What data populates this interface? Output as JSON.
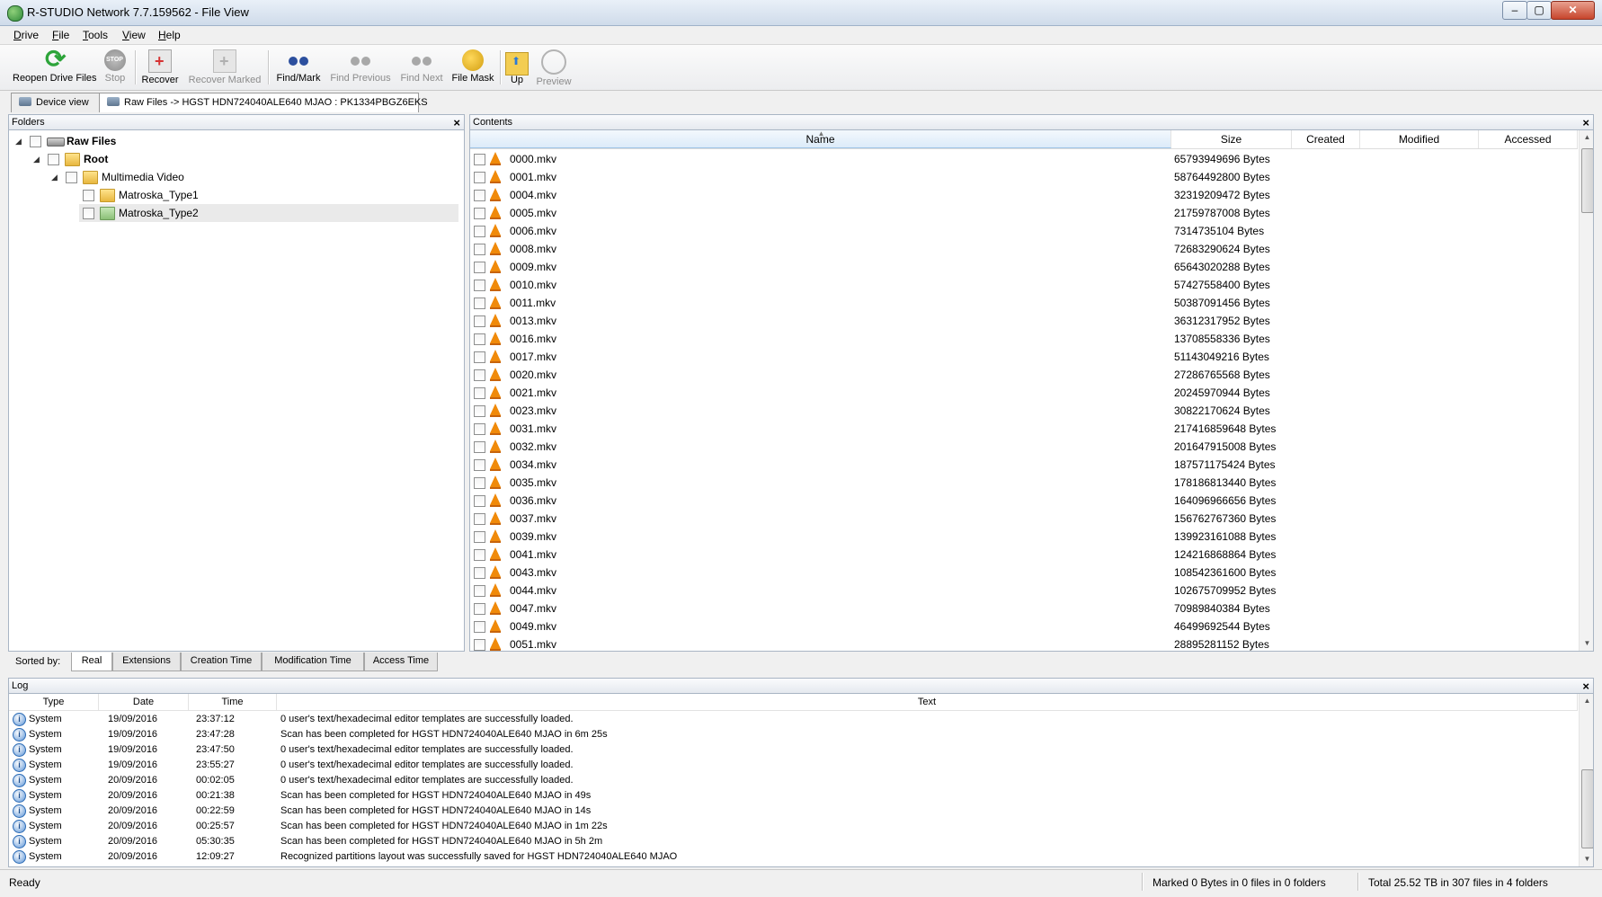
{
  "window": {
    "title": "R-STUDIO Network 7.7.159562 - File View",
    "min": "–",
    "max": "▢",
    "close": "✕"
  },
  "menu": [
    "Drive",
    "File",
    "Tools",
    "View",
    "Help"
  ],
  "toolbar": {
    "reopen": "Reopen Drive Files",
    "stop": "Stop",
    "recover": "Recover",
    "recover_marked": "Recover Marked",
    "find_mark": "Find/Mark",
    "find_previous": "Find Previous",
    "find_next": "Find Next",
    "file_mask": "File Mask",
    "up": "Up",
    "preview": "Preview"
  },
  "tabs": {
    "device_view": "Device view",
    "file_view": "Raw Files -> HGST HDN724040ALE640 MJAO : PK1334PBGZ6EKS"
  },
  "folders": {
    "header": "Folders",
    "items": [
      {
        "label": "Raw Files",
        "bold": true
      },
      {
        "label": "Root",
        "bold": true
      },
      {
        "label": "Multimedia Video"
      },
      {
        "label": "Matroska_Type1"
      },
      {
        "label": "Matroska_Type2"
      }
    ]
  },
  "contents": {
    "header": "Contents",
    "columns": {
      "name": "Name",
      "size": "Size",
      "created": "Created",
      "modified": "Modified",
      "accessed": "Accessed"
    },
    "files": [
      {
        "name": "0000.mkv",
        "size": "65793949696 Bytes"
      },
      {
        "name": "0001.mkv",
        "size": "58764492800 Bytes"
      },
      {
        "name": "0004.mkv",
        "size": "32319209472 Bytes"
      },
      {
        "name": "0005.mkv",
        "size": "21759787008 Bytes"
      },
      {
        "name": "0006.mkv",
        "size": "7314735104 Bytes"
      },
      {
        "name": "0008.mkv",
        "size": "72683290624 Bytes"
      },
      {
        "name": "0009.mkv",
        "size": "65643020288 Bytes"
      },
      {
        "name": "0010.mkv",
        "size": "57427558400 Bytes"
      },
      {
        "name": "0011.mkv",
        "size": "50387091456 Bytes"
      },
      {
        "name": "0013.mkv",
        "size": "36312317952 Bytes"
      },
      {
        "name": "0016.mkv",
        "size": "13708558336 Bytes"
      },
      {
        "name": "0017.mkv",
        "size": "51143049216 Bytes"
      },
      {
        "name": "0020.mkv",
        "size": "27286765568 Bytes"
      },
      {
        "name": "0021.mkv",
        "size": "20245970944 Bytes"
      },
      {
        "name": "0023.mkv",
        "size": "30822170624 Bytes"
      },
      {
        "name": "0031.mkv",
        "size": "217416859648 Bytes"
      },
      {
        "name": "0032.mkv",
        "size": "201647915008 Bytes"
      },
      {
        "name": "0034.mkv",
        "size": "187571175424 Bytes"
      },
      {
        "name": "0035.mkv",
        "size": "178186813440 Bytes"
      },
      {
        "name": "0036.mkv",
        "size": "164096966656 Bytes"
      },
      {
        "name": "0037.mkv",
        "size": "156762767360 Bytes"
      },
      {
        "name": "0039.mkv",
        "size": "139923161088 Bytes"
      },
      {
        "name": "0041.mkv",
        "size": "124216868864 Bytes"
      },
      {
        "name": "0043.mkv",
        "size": "108542361600 Bytes"
      },
      {
        "name": "0044.mkv",
        "size": "102675709952 Bytes"
      },
      {
        "name": "0047.mkv",
        "size": "70989840384 Bytes"
      },
      {
        "name": "0049.mkv",
        "size": "46499692544 Bytes"
      },
      {
        "name": "0051.mkv",
        "size": "28895281152 Bytes"
      }
    ]
  },
  "sort": {
    "label": "Sorted by:",
    "tabs": [
      "Real",
      "Extensions",
      "Creation Time",
      "Modification Time",
      "Access Time"
    ]
  },
  "log": {
    "header": "Log",
    "columns": {
      "type": "Type",
      "date": "Date",
      "time": "Time",
      "text": "Text"
    },
    "rows": [
      {
        "type": "System",
        "date": "19/09/2016",
        "time": "23:37:12",
        "text": "0 user's text/hexadecimal editor templates are successfully loaded."
      },
      {
        "type": "System",
        "date": "19/09/2016",
        "time": "23:47:28",
        "text": "Scan has been completed for HGST HDN724040ALE640 MJAO in 6m 25s"
      },
      {
        "type": "System",
        "date": "19/09/2016",
        "time": "23:47:50",
        "text": "0 user's text/hexadecimal editor templates are successfully loaded."
      },
      {
        "type": "System",
        "date": "19/09/2016",
        "time": "23:55:27",
        "text": "0 user's text/hexadecimal editor templates are successfully loaded."
      },
      {
        "type": "System",
        "date": "20/09/2016",
        "time": "00:02:05",
        "text": "0 user's text/hexadecimal editor templates are successfully loaded."
      },
      {
        "type": "System",
        "date": "20/09/2016",
        "time": "00:21:38",
        "text": "Scan has been completed for HGST HDN724040ALE640 MJAO in 49s"
      },
      {
        "type": "System",
        "date": "20/09/2016",
        "time": "00:22:59",
        "text": "Scan has been completed for HGST HDN724040ALE640 MJAO in 14s"
      },
      {
        "type": "System",
        "date": "20/09/2016",
        "time": "00:25:57",
        "text": "Scan has been completed for HGST HDN724040ALE640 MJAO in 1m 22s"
      },
      {
        "type": "System",
        "date": "20/09/2016",
        "time": "05:30:35",
        "text": "Scan has been completed for HGST HDN724040ALE640 MJAO in 5h 2m"
      },
      {
        "type": "System",
        "date": "20/09/2016",
        "time": "12:09:27",
        "text": "Recognized partitions layout was successfully saved for HGST HDN724040ALE640 MJAO"
      }
    ]
  },
  "status": {
    "ready": "Ready",
    "marked": "Marked 0 Bytes in 0 files in 0 folders",
    "total": "Total 25.52 TB in 307 files in 4 folders"
  },
  "icons": {
    "reopen": "refresh-icon",
    "stop": "stop-icon",
    "recover": "recover-icon",
    "recover_marked": "recover-marked-icon",
    "find": "binoculars-icon",
    "file_mask": "mask-icon",
    "up": "folder-up-icon",
    "preview": "preview-eye-icon",
    "file": "vlc-cone-icon",
    "log": "info-icon"
  }
}
